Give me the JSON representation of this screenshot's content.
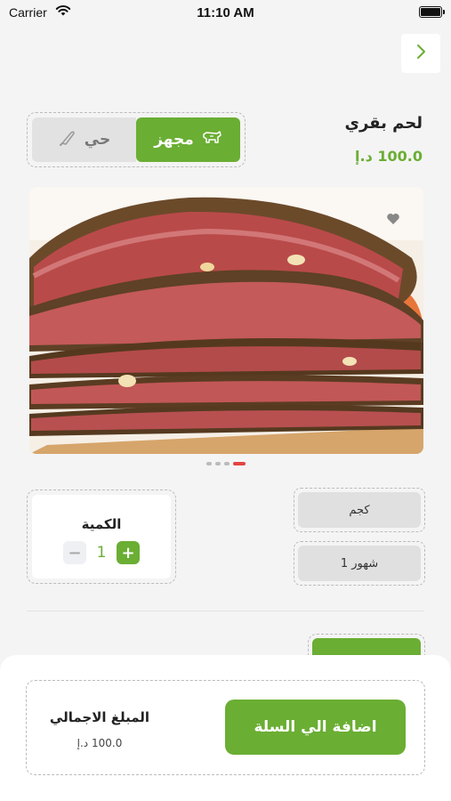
{
  "status_bar": {
    "carrier": "Carrier",
    "time": "11:10 AM"
  },
  "product": {
    "title": "لحم بقري",
    "price": "100.0 د.إ"
  },
  "type_toggle": {
    "active_label": "مجهز",
    "inactive_label": "حي",
    "selected": "مجهز"
  },
  "gallery": {
    "image_count": 4,
    "active_index": 3
  },
  "quantity": {
    "label": "الكمية",
    "value": "1",
    "minus": "−",
    "plus": "+"
  },
  "options": {
    "weight": "كجم",
    "age": "1 شهور"
  },
  "bottom": {
    "add_to_cart": "اضافة الي السلة",
    "total_label": "المبلغ الاجمالي",
    "total_value": "100.0 د.إ"
  },
  "colors": {
    "accent": "#6aae33",
    "indicator": "#e54343",
    "background": "#f4f4f4"
  },
  "icons": {
    "back": "chevron-right-icon",
    "prepared": "cow-icon",
    "live": "knife-icon",
    "favorite": "heart-icon",
    "wifi": "wifi-icon",
    "battery": "battery-icon"
  }
}
